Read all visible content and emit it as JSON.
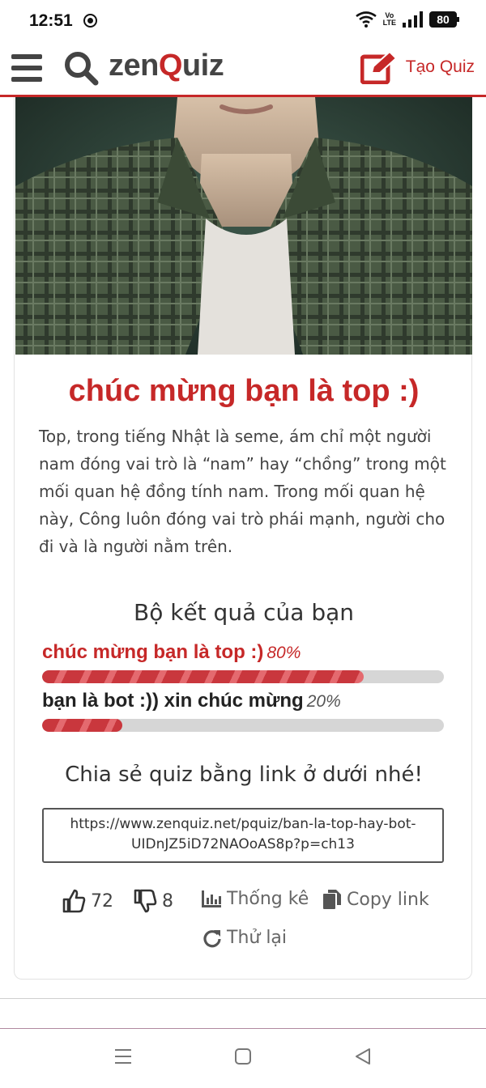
{
  "status_bar": {
    "time": "12:51",
    "volte_top": "Vo",
    "volte_bottom": "LTE",
    "battery": "80"
  },
  "header": {
    "logo_left": "zen",
    "logo_q": "Q",
    "logo_right": "uiz",
    "create_label": "Tạo Quiz",
    "accent_color": "#c62828"
  },
  "result": {
    "title": "chúc mừng bạn là top :)",
    "description": "Top, trong tiếng Nhật là seme, ám chỉ một người nam đóng vai trò là “nam” hay “chồng” trong một mối quan hệ đồng tính nam. Trong mối quan hệ này, Công luôn đóng vai trò phái mạnh, người cho đi và là người nằm trên."
  },
  "result_set": {
    "title": "Bộ kết quả của bạn",
    "items": [
      {
        "label": "chúc mừng bạn là top :)",
        "percent": "80%",
        "value": 0.8
      },
      {
        "label": "bạn là bot :)) xin chúc mừng",
        "percent": "20%",
        "value": 0.2
      }
    ]
  },
  "share": {
    "title": "Chia sẻ quiz bằng link ở dưới nhé!",
    "link_line1": "https://www.zenquiz.net/pquiz/ban-la-top-hay-bot-",
    "link_line2": "UIDnJZ5iD72NAOoAS8p?p=ch13"
  },
  "actions": {
    "likes": "72",
    "dislikes": "8",
    "stats_label": "Thống kê",
    "copy_label": "Copy link",
    "retry_label": "Thử lại"
  },
  "icons": [
    "globe-icon",
    "wifi-icon",
    "signal-icon",
    "battery-icon",
    "menu-icon",
    "search-icon",
    "edit-icon",
    "thumbs-up-icon",
    "thumbs-down-icon",
    "chart-icon",
    "copy-icon",
    "refresh-icon",
    "nav-recents-icon",
    "nav-home-icon",
    "nav-back-icon"
  ]
}
